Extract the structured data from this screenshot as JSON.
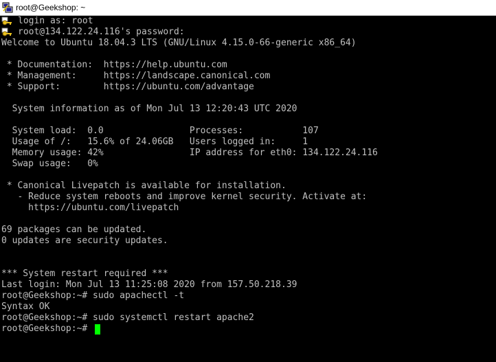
{
  "window": {
    "title": "root@Geekshop: ~",
    "icon": "putty-terminal-icon"
  },
  "terminal": {
    "colors": {
      "background": "#000000",
      "text": "#c0c0c0",
      "cursor": "#00ff00"
    },
    "lines": [
      "login as: root",
      "root@134.122.24.116's password:",
      "Welcome to Ubuntu 18.04.3 LTS (GNU/Linux 4.15.0-66-generic x86_64)",
      "",
      " * Documentation:  https://help.ubuntu.com",
      " * Management:     https://landscape.canonical.com",
      " * Support:        https://ubuntu.com/advantage",
      "",
      "  System information as of Mon Jul 13 12:20:43 UTC 2020",
      "",
      "  System load:  0.0                Processes:           107",
      "  Usage of /:   15.6% of 24.06GB   Users logged in:     1",
      "  Memory usage: 42%                IP address for eth0: 134.122.24.116",
      "  Swap usage:   0%",
      "",
      " * Canonical Livepatch is available for installation.",
      "   - Reduce system reboots and improve kernel security. Activate at:",
      "     https://ubuntu.com/livepatch",
      "",
      "69 packages can be updated.",
      "0 updates are security updates.",
      "",
      "",
      "*** System restart required ***",
      "Last login: Mon Jul 13 11:25:08 2020 from 157.50.218.39",
      "root@Geekshop:~# sudo apachectl -t",
      "Syntax OK",
      "root@Geekshop:~# sudo systemctl restart apache2",
      "root@Geekshop:~# "
    ]
  }
}
